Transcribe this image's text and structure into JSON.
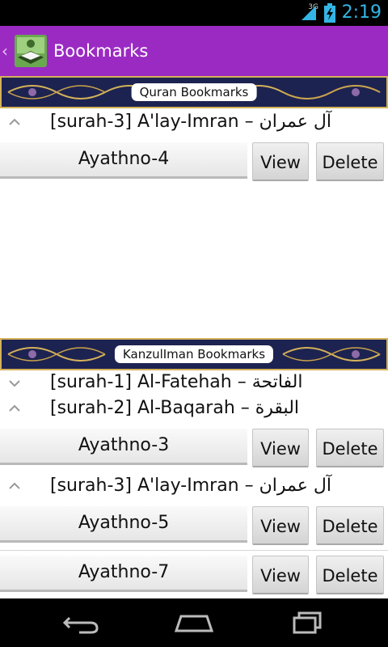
{
  "status_bar": {
    "network": "3G",
    "time": "2:19"
  },
  "action_bar": {
    "title": "Bookmarks"
  },
  "sections": {
    "quran": {
      "banner_label": "Quran Bookmarks",
      "groups": [
        {
          "label": "[surah-3] A'lay-Imran – آل عمران",
          "expanded": true,
          "items": [
            {
              "label": "Ayathno-4"
            }
          ]
        }
      ]
    },
    "kanzul": {
      "banner_label": "KanzulIman Bookmarks",
      "groups": [
        {
          "label": "[surah-1] Al-Fatehah – الفاتحة",
          "expanded": false,
          "items": []
        },
        {
          "label": "[surah-2] Al-Baqarah – البقرة",
          "expanded": true,
          "items": [
            {
              "label": "Ayathno-3"
            }
          ]
        },
        {
          "label": "[surah-3] A'lay-Imran – آل عمران",
          "expanded": true,
          "items": [
            {
              "label": "Ayathno-5"
            },
            {
              "label": "Ayathno-7"
            }
          ]
        }
      ]
    }
  },
  "buttons": {
    "view_label": "View",
    "delete_label": "Delete"
  },
  "colors": {
    "action_bar": "#9b2ac3",
    "status_accent": "#33b5e5",
    "banner_bg": "#1d2350",
    "banner_gold": "#d4b15a"
  }
}
